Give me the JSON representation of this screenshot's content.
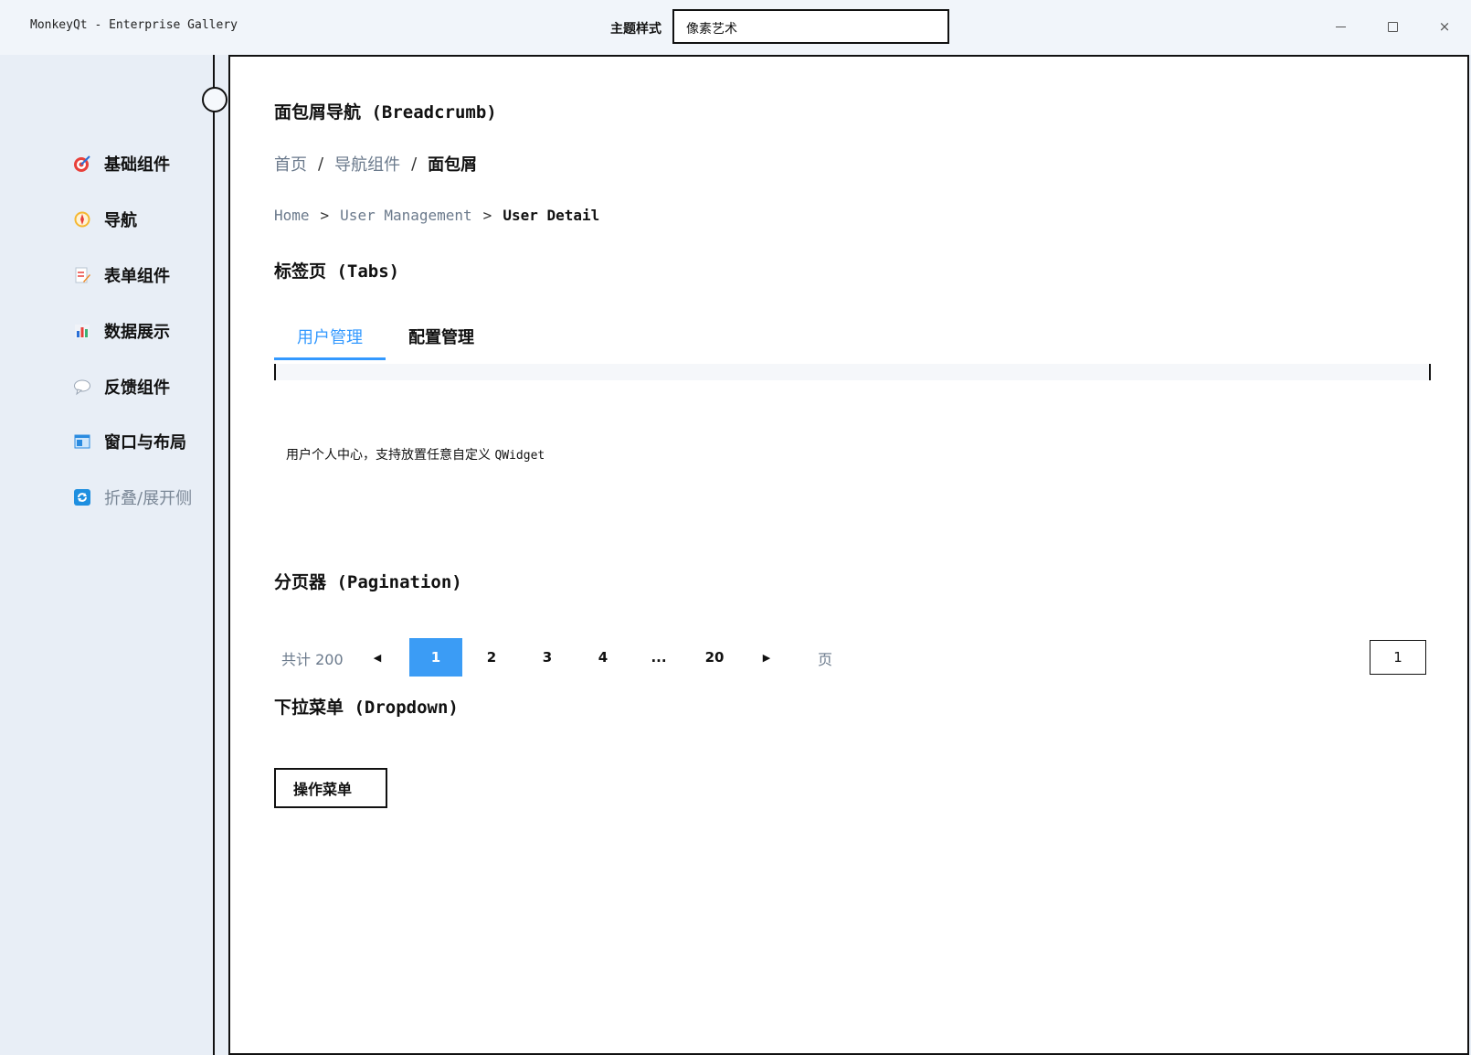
{
  "window": {
    "title": "MonkeyQt - Enterprise Gallery",
    "theme_label": "主题样式",
    "theme_value": "像素艺术",
    "controls": {
      "minimize": "",
      "maximize": "",
      "close": "×"
    }
  },
  "sidebar": {
    "items": [
      {
        "label": "基础组件",
        "icon": "target-icon"
      },
      {
        "label": "导航",
        "icon": "compass-icon"
      },
      {
        "label": "表单组件",
        "icon": "form-edit-icon"
      },
      {
        "label": "数据展示",
        "icon": "bar-chart-icon"
      },
      {
        "label": "反馈组件",
        "icon": "speech-bubble-icon"
      },
      {
        "label": "窗口与布局",
        "icon": "window-layout-icon"
      }
    ],
    "toggle_label": "折叠/展开侧",
    "toggle_icon": "refresh-icon"
  },
  "breadcrumb_section": {
    "title": "面包屑导航 (Breadcrumb)",
    "cn": {
      "items": [
        "首页",
        "导航组件"
      ],
      "current": "面包屑",
      "separator": "/"
    },
    "en": {
      "items": [
        "Home",
        "User Management"
      ],
      "current": "User Detail",
      "separator": ">"
    }
  },
  "tabs_section": {
    "title": "标签页 (Tabs)",
    "tabs": [
      "用户管理",
      "配置管理"
    ],
    "active_tab": 0,
    "body_text": "用户个人中心，支持放置任意自定义",
    "body_code": "QWidget"
  },
  "pagination_section": {
    "title": "分页器 (Pagination)",
    "total_label": "共计 200",
    "prev": "◀",
    "pages": [
      "1",
      "2",
      "3",
      "4",
      "...",
      "20"
    ],
    "active_page": "1",
    "next": "▶",
    "unit": "页",
    "jump_value": "1"
  },
  "dropdown_section": {
    "title": "下拉菜单 (Dropdown)",
    "button_label": "操作菜单"
  },
  "colors": {
    "accent": "#3399ff",
    "active_page": "#3b9cf5",
    "muted": "#6b7a8c"
  }
}
